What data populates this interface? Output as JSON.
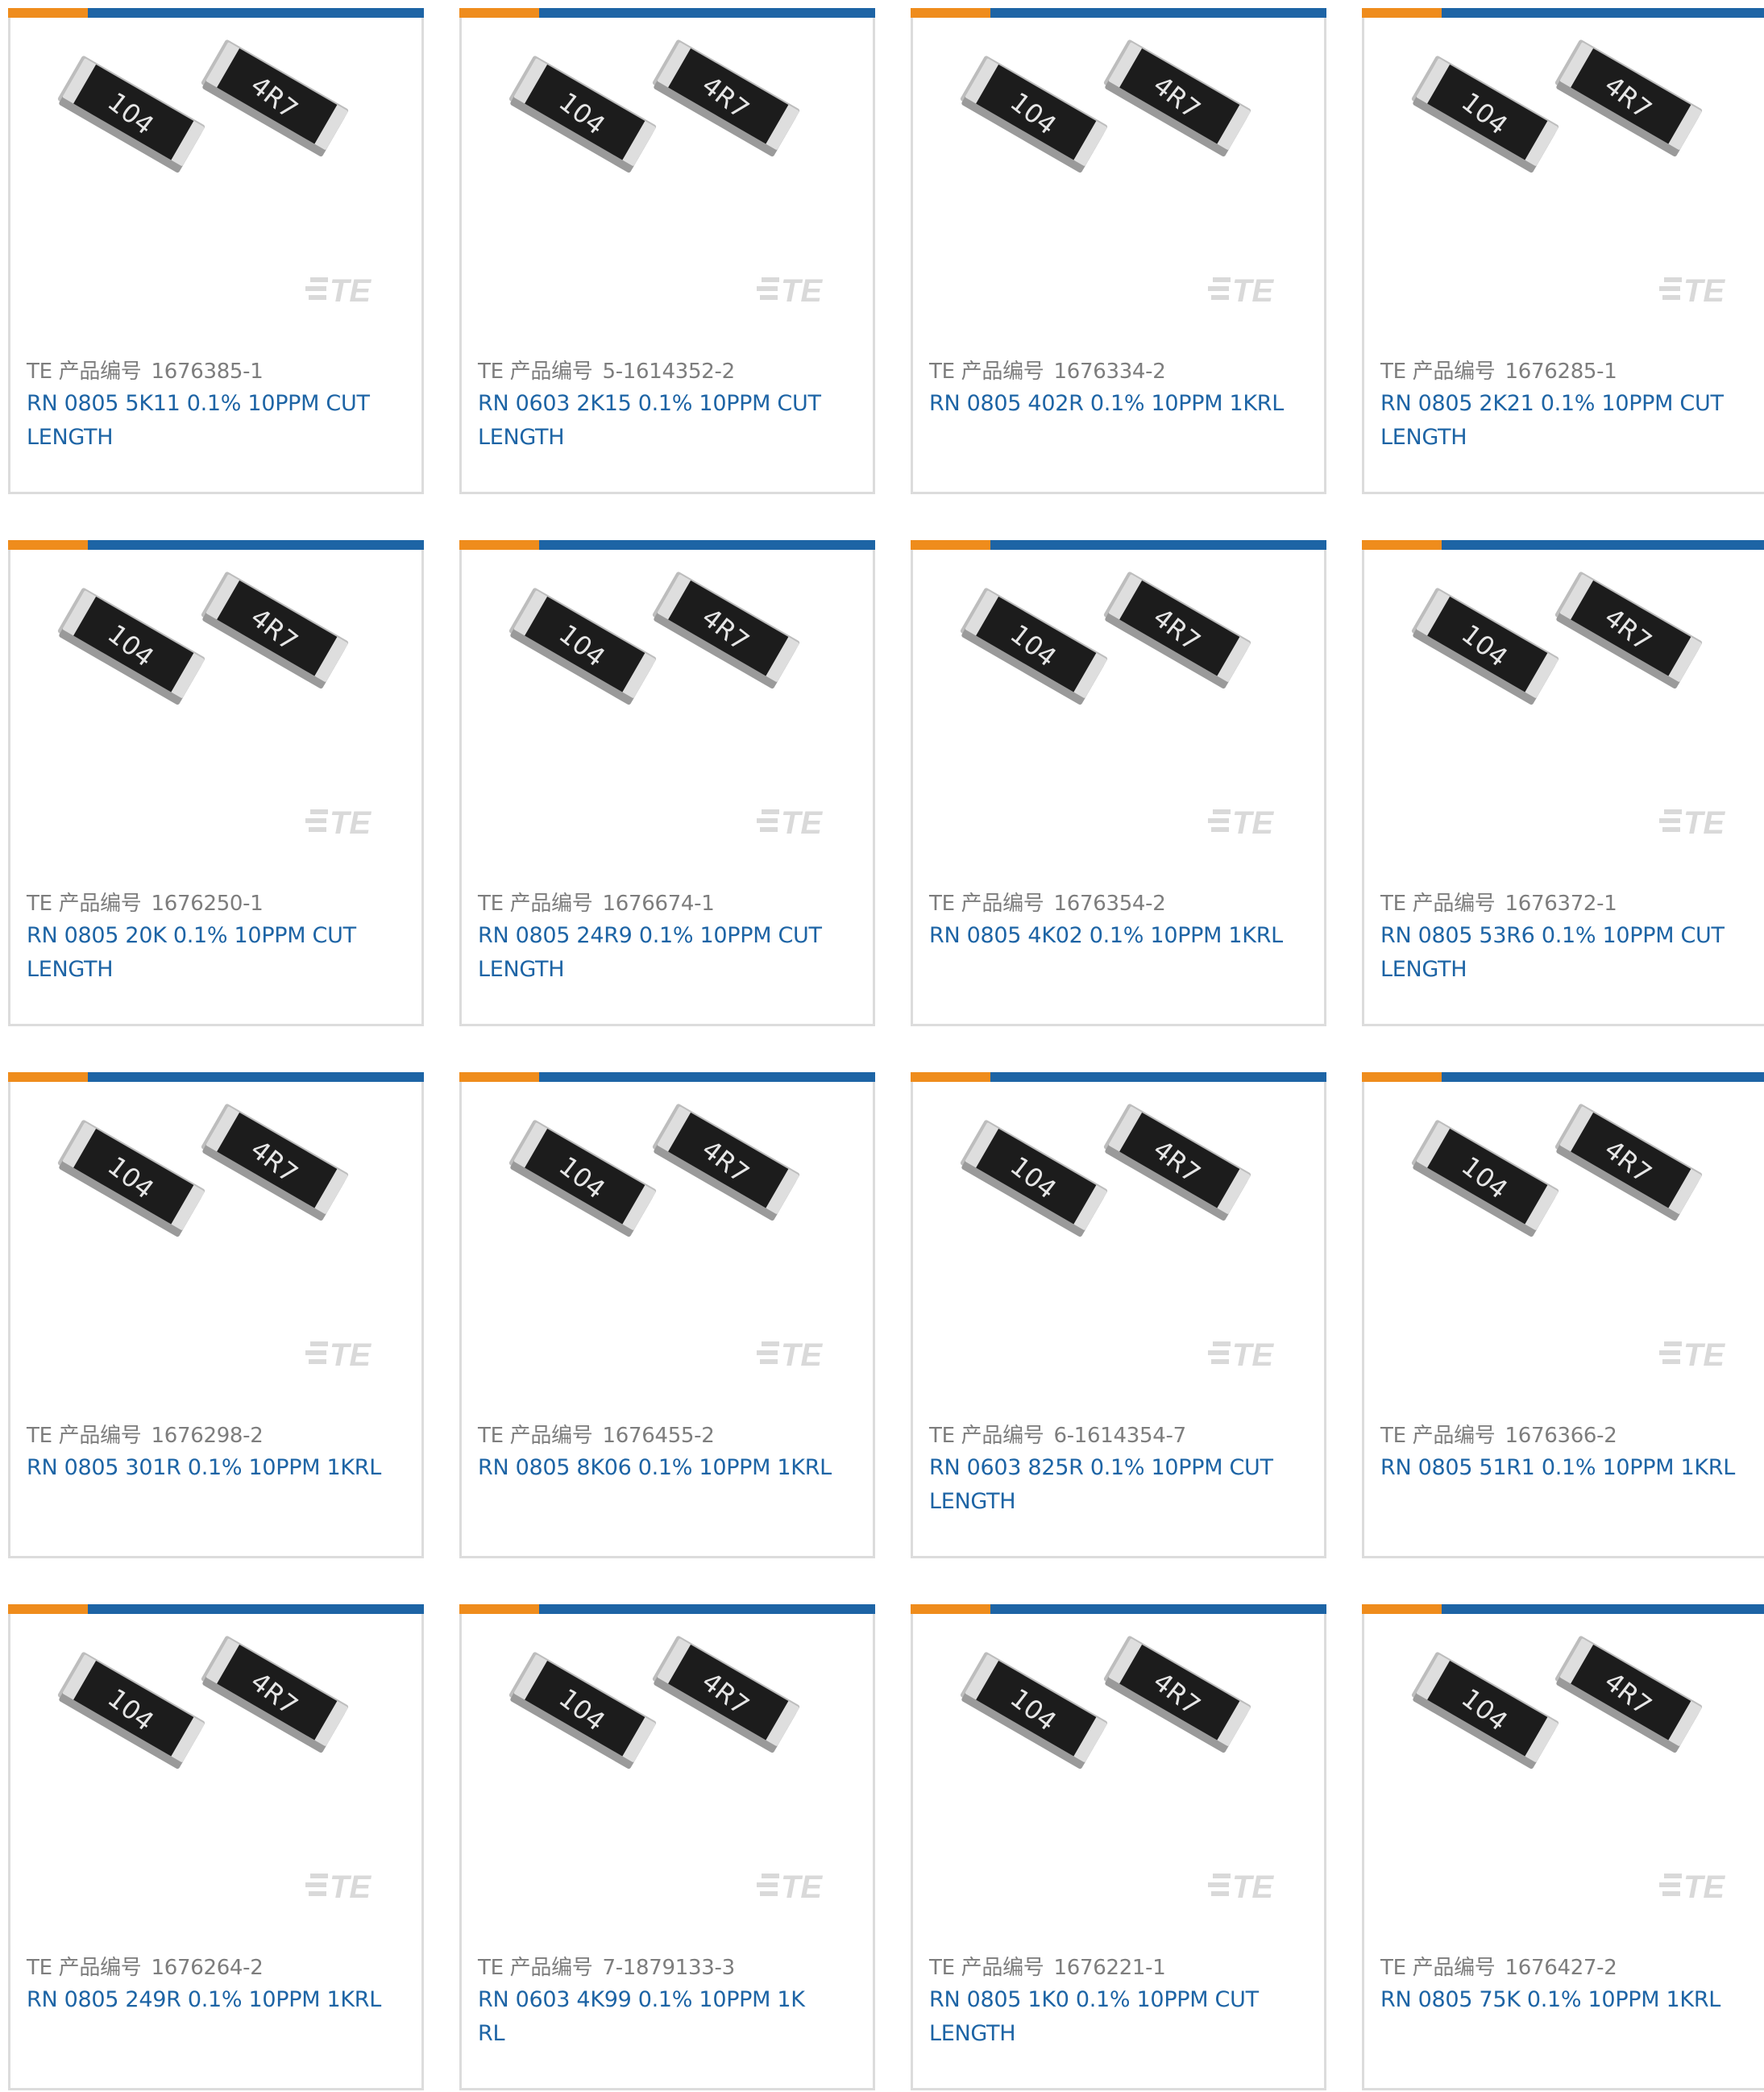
{
  "colors": {
    "accent_orange": "#ef8c1c",
    "accent_blue": "#1d64a5",
    "link": "#1d64a5",
    "label_gray": "#7d7d7d",
    "card_border": "#dcdcdc"
  },
  "card_common": {
    "pn_label": "TE 产品编号",
    "image_marks": {
      "chip_left": "104",
      "chip_right": "4R7",
      "logo": "TE"
    }
  },
  "products": [
    {
      "pn": "1676385-1",
      "desc": "RN 0805 5K11 0.1% 10PPM CUT LENGTH"
    },
    {
      "pn": "5-1614352-2",
      "desc": "RN 0603 2K15 0.1% 10PPM CUT LENGTH"
    },
    {
      "pn": "1676334-2",
      "desc": "RN 0805 402R 0.1% 10PPM 1KRL"
    },
    {
      "pn": "1676285-1",
      "desc": "RN 0805 2K21 0.1% 10PPM CUT LENGTH"
    },
    {
      "pn": "1676250-1",
      "desc": "RN 0805 20K 0.1% 10PPM CUT LENGTH"
    },
    {
      "pn": "1676674-1",
      "desc": "RN 0805 24R9 0.1% 10PPM CUT LENGTH"
    },
    {
      "pn": "1676354-2",
      "desc": "RN 0805 4K02 0.1% 10PPM 1KRL"
    },
    {
      "pn": "1676372-1",
      "desc": "RN 0805 53R6 0.1% 10PPM CUT LENGTH"
    },
    {
      "pn": "1676298-2",
      "desc": "RN 0805 301R 0.1% 10PPM 1KRL"
    },
    {
      "pn": "1676455-2",
      "desc": "RN 0805 8K06 0.1% 10PPM 1KRL"
    },
    {
      "pn": "6-1614354-7",
      "desc": "RN 0603 825R 0.1% 10PPM CUT LENGTH"
    },
    {
      "pn": "1676366-2",
      "desc": "RN 0805 51R1 0.1% 10PPM 1KRL"
    },
    {
      "pn": "1676264-2",
      "desc": "RN 0805 249R 0.1% 10PPM 1KRL"
    },
    {
      "pn": "7-1879133-3",
      "desc": "RN 0603 4K99 0.1% 10PPM 1K RL"
    },
    {
      "pn": "1676221-1",
      "desc": "RN 0805 1K0 0.1% 10PPM CUT LENGTH"
    },
    {
      "pn": "1676427-2",
      "desc": "RN 0805 75K 0.1% 10PPM 1KRL"
    }
  ]
}
